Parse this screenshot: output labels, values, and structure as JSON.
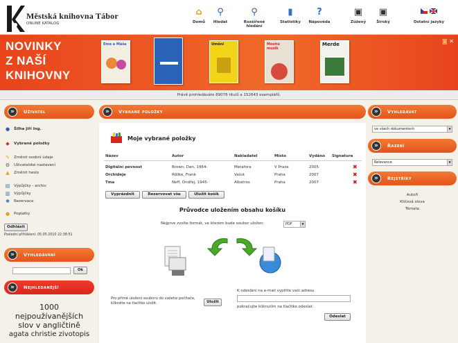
{
  "header": {
    "title": "Městská knihovna Tábor",
    "subtitle": "Online katalog",
    "nav": [
      {
        "label": "Domů",
        "icon": "house-icon"
      },
      {
        "label": "Hledat",
        "icon": "magnifier-icon"
      },
      {
        "label": "Rozšířené hledání",
        "icon": "advanced-search-icon"
      },
      {
        "label": "Statistiky",
        "icon": "stats-icon"
      },
      {
        "label": "Nápověda",
        "icon": "help-icon"
      },
      {
        "label": "Zúžený",
        "icon": "narrow-screen-icon"
      },
      {
        "label": "Široký",
        "icon": "wide-screen-icon"
      },
      {
        "label": "Ostatní jazyky",
        "icon": "flags-icon"
      }
    ]
  },
  "banner": {
    "text_lines": [
      "NOVINKY",
      "Z NAŠÍ",
      "KNIHOVNY"
    ],
    "books": [
      {
        "title": "Ema a Máša",
        "color": "#f2efe0"
      },
      {
        "title": "",
        "color": "#2a62b8"
      },
      {
        "title": "Umění",
        "color": "#f2d418"
      },
      {
        "title": "Mnoho muzik",
        "color": "#e8e0d2"
      },
      {
        "title": "Merde",
        "color": "#f4f2ee"
      }
    ]
  },
  "status_line": "Právě prohledáváte 89076 titulů a 152643 exemplářů.",
  "user_panel": {
    "title": "Uživatel",
    "user_name": "Šilha Jiří Ing.",
    "items": [
      {
        "label": "Vybrané položky",
        "icon": "basket-icon",
        "bold": true
      },
      {
        "label": "Změnit osobní údaje",
        "icon": "pencil-icon",
        "bold": false
      },
      {
        "label": "Uživatelské nastavení",
        "icon": "settings-icon",
        "bold": false
      },
      {
        "label": "Změnit heslo",
        "icon": "lock-icon",
        "bold": false
      },
      {
        "label": "Výpůjčky - archiv",
        "icon": "archive-icon",
        "bold": false
      },
      {
        "label": "Výpůjčky",
        "icon": "books-icon",
        "bold": false
      },
      {
        "label": "Rezervace",
        "icon": "reservation-icon",
        "bold": false
      },
      {
        "label": "Poplatky",
        "icon": "coins-icon",
        "bold": false
      }
    ],
    "logout_button": "Odhlásit",
    "last_login": "Poslední přihlášení: 05.05.2010 22:38:51"
  },
  "search_panel": {
    "title": "Vyhledávání",
    "input_value": "",
    "go_button": "Ok"
  },
  "popular_panel": {
    "title": "Nejhledanější",
    "line1": "1000",
    "line2": "nejpoužívanějších",
    "line3": "slov v angličtině",
    "line4": "agata christie zivotopis"
  },
  "main": {
    "title": "Vybrané položky",
    "inner_title": "Moje vybrané položky",
    "columns": [
      "Název",
      "Autor",
      "Nakladatel",
      "Místo",
      "Vydáno",
      "Signatura"
    ],
    "rows": [
      {
        "title": "Digitální pevnost",
        "author": "Brown, Dan, 1964-",
        "publisher": "Metafora",
        "place": "V Praze",
        "year": "2005"
      },
      {
        "title": "Orchideje",
        "author": "Röllke, Frank",
        "publisher": "Vašut",
        "place": "Praha",
        "year": "2007"
      },
      {
        "title": "Tma",
        "author": "Neff, Ondřej, 1945-",
        "publisher": "Albatros",
        "place": "Praha",
        "year": "2007"
      }
    ],
    "buttons": [
      "Vyprázdnit",
      "Rezervovat vše",
      "Uložit košík"
    ],
    "guide_title": "Průvodce uložením obsahu košíku",
    "format_label": "Nejprve zvolte formát, ve kterém bude soubor uložen:",
    "format_value": "PDF",
    "save_text": "Pro přímé uložení souboru do vašeho počítače, klikněte na tlačítko uložit.",
    "save_button": "Uložit",
    "email_label": "K odeslání na e-mail vyplňte vaši adresu",
    "email_value": "",
    "email_text": "pokračujte kliknutím na tlačítko odeslat.",
    "send_button": "Odeslat"
  },
  "right": {
    "search_title": "Vyhledávat",
    "search_select": "ve všech dokumentech",
    "sort_title": "Řazení",
    "sort_select": "Relevance",
    "index_title": "Rejstříky",
    "index_links": [
      "Autoři",
      "Klíčová slova",
      "Témata"
    ]
  },
  "colors": {
    "accent": "#e8541e",
    "red_header": "#d8281c",
    "delete": "#d01a14"
  }
}
